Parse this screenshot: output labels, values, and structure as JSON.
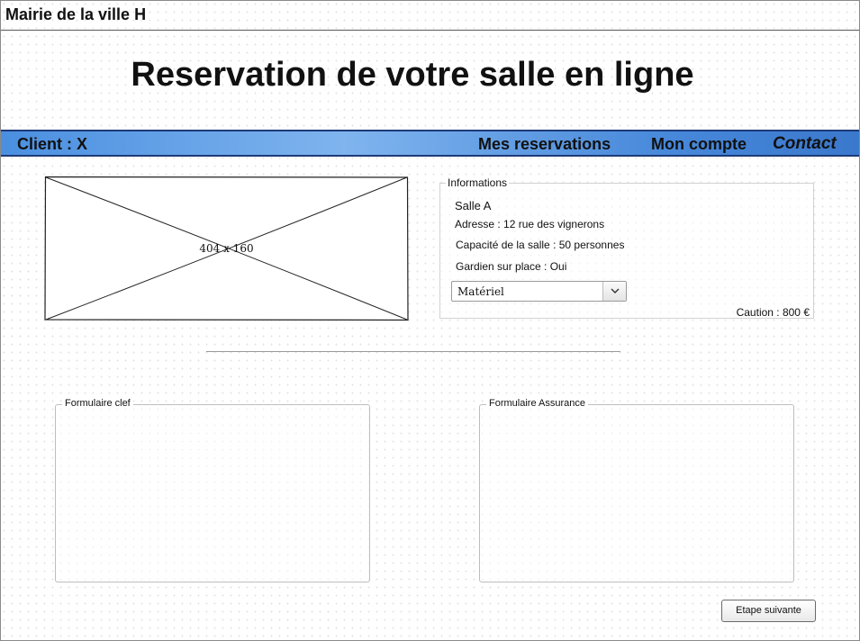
{
  "app": {
    "title": "Mairie de la ville H"
  },
  "header": {
    "page_title": "Reservation de votre salle en ligne"
  },
  "nav": {
    "client_label": "Client : X",
    "reservations_label": "Mes reservations",
    "account_label": "Mon compte",
    "contact_label": "Contact",
    "colors": {
      "bar": "#5b9be6",
      "border": "#1d3a78"
    }
  },
  "image": {
    "dimension_label": "404 x 160"
  },
  "info": {
    "legend": "Informations",
    "salle": "Salle A",
    "adresse": "Adresse : 12 rue des vignerons",
    "capacite": "Capacité de la salle : 50 personnes",
    "gardien": "Gardien sur place : Oui",
    "materiel_select": {
      "selected": "Matériel",
      "icon": "chevron-down-icon"
    },
    "caution": "Caution : 800 €"
  },
  "forms": {
    "clef_legend": "Formulaire clef",
    "assurance_legend": "Formulaire Assurance"
  },
  "actions": {
    "next_label": "Etape suivante"
  }
}
